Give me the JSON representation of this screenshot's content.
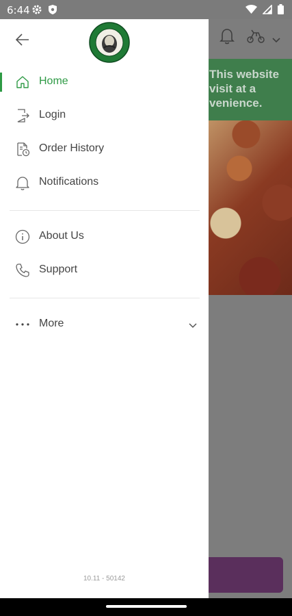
{
  "status": {
    "time": "6:44",
    "icons_left": [
      "gear-icon",
      "shield-icon"
    ],
    "icons_right": [
      "wifi-icon",
      "cellular-icon",
      "battery-icon"
    ]
  },
  "background": {
    "notice": "This website\nvisit at a\nvenience.",
    "icons": [
      "bell-icon",
      "scooter-icon",
      "chevron-down-icon"
    ],
    "colors": {
      "banner": "#3f7e4c",
      "button": "#5a2f5c"
    }
  },
  "drawer": {
    "logo": "PAPA MAMA PIZZERIA",
    "menu_primary": [
      {
        "label": "Home",
        "icon": "home-icon",
        "active": true
      },
      {
        "label": "Login",
        "icon": "login-icon",
        "active": false
      },
      {
        "label": "Order History",
        "icon": "order-history-icon",
        "active": false
      },
      {
        "label": "Notifications",
        "icon": "bell-icon",
        "active": false
      }
    ],
    "menu_secondary": [
      {
        "label": "About Us",
        "icon": "info-icon"
      },
      {
        "label": "Support",
        "icon": "phone-icon"
      }
    ],
    "more": {
      "label": "More",
      "icon": "more-dots-icon"
    },
    "version": "10.11 - 50142",
    "accent_color": "#2e9a45"
  }
}
